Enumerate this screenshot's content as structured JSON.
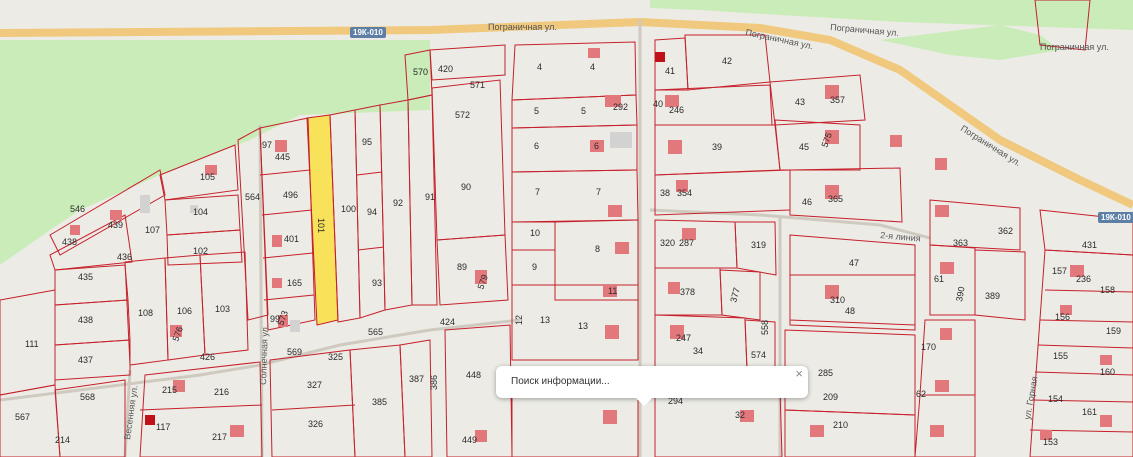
{
  "roads": {
    "pogranichnaya": "Пограничная ул.",
    "solnechnaya": "Солнечная ул.",
    "vesennyaya": "Весенняя ул.",
    "second_alley": "2-я линия",
    "gornaya": "ул. Горная"
  },
  "shields": [
    "19К-010",
    "19К-010"
  ],
  "popup": {
    "text": "Поиск информации...",
    "close": "×"
  },
  "plots": [
    "546",
    "438",
    "439",
    "107",
    "105",
    "97",
    "445",
    "496",
    "401",
    "165",
    "99",
    "564",
    "101",
    "100",
    "95",
    "94",
    "93",
    "92",
    "91",
    "90",
    "89",
    "570",
    "420",
    "571",
    "572",
    "435",
    "436",
    "104",
    "102",
    "108",
    "106",
    "103",
    "438",
    "437",
    "111",
    "426",
    "569",
    "325",
    "327",
    "385",
    "326",
    "387",
    "386",
    "424",
    "565",
    "448",
    "449",
    "12",
    "13",
    "13",
    "4",
    "4",
    "5",
    "5",
    "292",
    "6",
    "6",
    "7",
    "7",
    "10",
    "8",
    "9",
    "11",
    "41",
    "42",
    "40",
    "246",
    "43",
    "357",
    "39",
    "45",
    "38",
    "354",
    "46",
    "365",
    "320",
    "287",
    "319",
    "47",
    "378",
    "377",
    "310",
    "48",
    "247",
    "34",
    "574",
    "285",
    "209",
    "210",
    "32",
    "363",
    "362",
    "431",
    "61",
    "390",
    "389",
    "157",
    "236",
    "158",
    "156",
    "159",
    "170",
    "155",
    "62",
    "154",
    "160",
    "161",
    "153",
    "214",
    "568",
    "567",
    "215",
    "216",
    "217",
    "117",
    "573",
    "576",
    "575",
    "579",
    "294",
    "558"
  ],
  "colors": {
    "plot_border": "#c6202a",
    "building": "#e2787c",
    "highlight": "#f8e25a",
    "forest": "#c9ecb8",
    "road": "#f0c97e"
  }
}
